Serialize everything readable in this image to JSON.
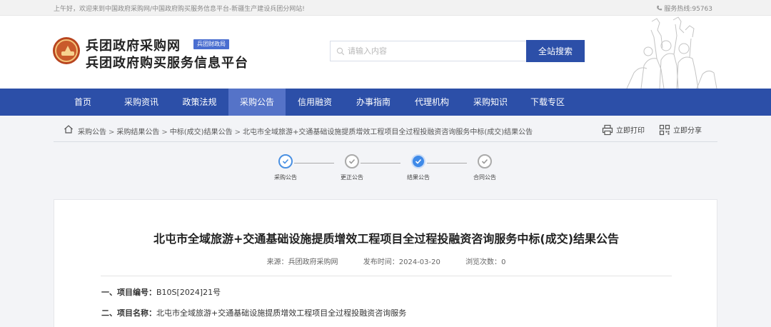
{
  "topbar": {
    "welcome": "上午好，欢迎来到中国政府采购网/中国政府购买服务信息平台-新疆生产建设兵团分网站!",
    "hotline": "服务热线:95763"
  },
  "header": {
    "title_line1": "兵团政府采购网",
    "title_line2": "兵团政府购买服务信息平台",
    "badge": "兵团财政局",
    "search_placeholder": "请输入内容",
    "search_button": "全站搜索"
  },
  "nav": {
    "items": [
      {
        "label": "首页"
      },
      {
        "label": "采购资讯"
      },
      {
        "label": "政策法规"
      },
      {
        "label": "采购公告"
      },
      {
        "label": "信用融资"
      },
      {
        "label": "办事指南"
      },
      {
        "label": "代理机构"
      },
      {
        "label": "采购知识"
      },
      {
        "label": "下载专区"
      }
    ],
    "active": "采购公告"
  },
  "breadcrumb": {
    "items": [
      "采购公告",
      "采购结果公告",
      "中标(成交)结果公告",
      "北屯市全域旅游+交通基础设施提质增效工程项目全过程投融资咨询服务中标(成交)结果公告"
    ],
    "separator": ">"
  },
  "actions": {
    "print": "立即打印",
    "share": "立即分享"
  },
  "steps": [
    {
      "label": "采购公告",
      "state": "done"
    },
    {
      "label": "更正公告",
      "state": "inactive"
    },
    {
      "label": "结果公告",
      "state": "current"
    },
    {
      "label": "合同公告",
      "state": "inactive"
    }
  ],
  "article": {
    "title": "北屯市全域旅游+交通基础设施提质增效工程项目全过程投融资咨询服务中标(成交)结果公告",
    "source_label": "来源：",
    "source": "兵团政府采购网",
    "date_label": "发布时间：",
    "date": "2024-03-20",
    "views_label": "浏览次数：",
    "views": "0",
    "fields": [
      {
        "label": "一、项目编号：",
        "value": "B10S[2024]21号"
      },
      {
        "label": "二、项目名称：",
        "value": "北屯市全域旅游+交通基础设施提质增效工程项目全过程投融资咨询服务"
      }
    ]
  },
  "colors": {
    "nav_bg": "#2c4fa8",
    "nav_active": "#5573c8",
    "step_current": "#3f8ae8"
  }
}
